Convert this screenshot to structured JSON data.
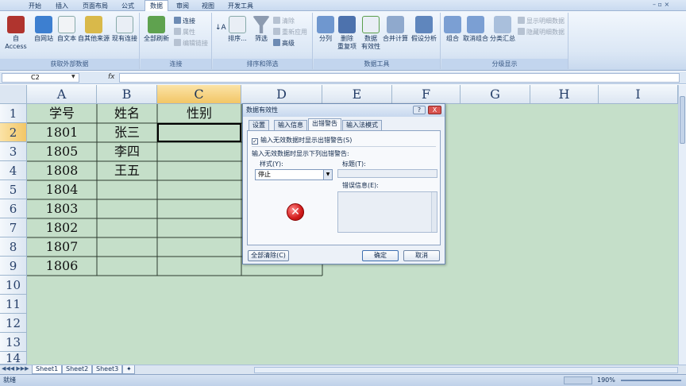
{
  "tabs": [
    "开始",
    "插入",
    "页面布局",
    "公式",
    "数据",
    "审阅",
    "视图",
    "开发工具"
  ],
  "active_tab": "数据",
  "ribbon": {
    "group_external": {
      "label": "获取外部数据",
      "buttons": [
        "自 Access",
        "自网站",
        "自文本",
        "自其他来源",
        "现有连接"
      ]
    },
    "group_connect": {
      "label": "连接",
      "refresh": "全部刷新",
      "small": [
        "连接",
        "属性",
        "编辑链接"
      ]
    },
    "group_sort": {
      "label": "排序和筛选",
      "sort": "排序...",
      "filter": "筛选",
      "small": [
        "清除",
        "重新应用",
        "高级"
      ]
    },
    "group_tools": {
      "label": "数据工具",
      "buttons": [
        "分列",
        "删除\n重复项",
        "数据\n有效性",
        "合并计算",
        "假设分析"
      ]
    },
    "group_outline": {
      "label": "分级显示",
      "buttons": [
        "组合",
        "取消组合",
        "分类汇总"
      ],
      "small": [
        "显示明细数据",
        "隐藏明细数据"
      ]
    }
  },
  "formula_bar": {
    "name_box": "C2",
    "fx": "fx",
    "formula": ""
  },
  "sheet": {
    "columns": [
      "A",
      "B",
      "C",
      "D",
      "E",
      "F",
      "G",
      "H",
      "I"
    ],
    "selected_column": "C",
    "rows": [
      "1",
      "2",
      "3",
      "4",
      "5",
      "6",
      "7",
      "8",
      "9",
      "10",
      "11",
      "12",
      "13",
      "14"
    ],
    "selected_row": "2",
    "headers": {
      "A": "学号",
      "B": "姓名",
      "C": "性别"
    },
    "data": [
      {
        "id": "1801",
        "name": "张三"
      },
      {
        "id": "1805",
        "name": "李四"
      },
      {
        "id": "1808",
        "name": "王五"
      },
      {
        "id": "1804",
        "name": ""
      },
      {
        "id": "1803",
        "name": ""
      },
      {
        "id": "1802",
        "name": ""
      },
      {
        "id": "1807",
        "name": ""
      },
      {
        "id": "1806",
        "name": ""
      }
    ],
    "sheet_tabs": [
      "Sheet1",
      "Sheet2",
      "Sheet3"
    ],
    "active_sheet": "Sheet1",
    "background_color": "#c5dfc9"
  },
  "status": {
    "ready": "就绪",
    "zoom": "190%"
  },
  "dialog": {
    "title": "数据有效性",
    "help": "?",
    "close": "X",
    "tabs": [
      "设置",
      "输入信息",
      "出错警告",
      "输入法模式"
    ],
    "active_tab": "出错警告",
    "checkbox_label": "输入无效数据时显示出错警告(S)",
    "checkbox_checked": true,
    "section_label": "输入无效数据时显示下列出错警告:",
    "style_label": "样式(Y):",
    "style_value": "停止",
    "title_label": "标题(T):",
    "message_label": "错误信息(E):",
    "icon": "error-stop-icon",
    "clear_all": "全部清除(C)",
    "ok": "确定",
    "cancel": "取消"
  }
}
